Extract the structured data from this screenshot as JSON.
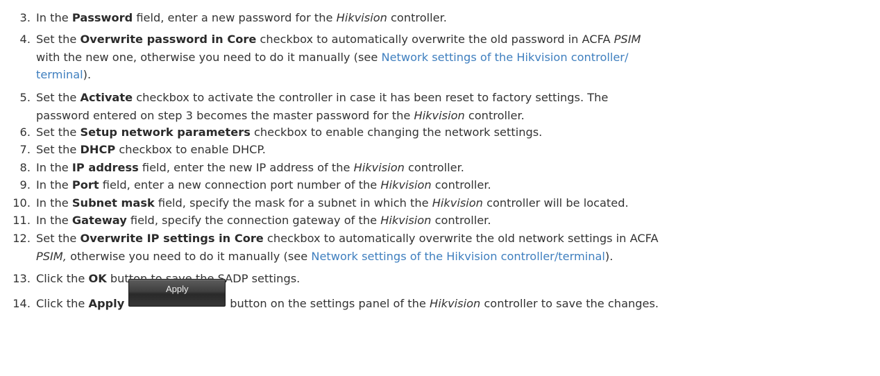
{
  "steps": [
    {
      "number": "3.",
      "parts": [
        {
          "t": "In the "
        },
        {
          "t": "Password",
          "s": "b"
        },
        {
          "t": " field, enter a new password for the "
        },
        {
          "t": "Hikvision",
          "s": "i"
        },
        {
          "t": " controller."
        }
      ]
    },
    {
      "number": "4.",
      "lines": [
        [
          {
            "t": "Set the "
          },
          {
            "t": "Overwrite password in Core",
            "s": "b"
          },
          {
            "t": " checkbox to automatically overwrite the old password in ACFA "
          },
          {
            "t": "PSIM",
            "s": "i"
          }
        ],
        [
          {
            "t": "with the new one, otherwise you need to do it manually (see "
          },
          {
            "t": "Network settings of the Hikvision controller/",
            "s": "a",
            "name": "network-settings-link"
          }
        ],
        [
          {
            "t": "terminal",
            "s": "a",
            "name": "network-settings-link"
          },
          {
            "t": ")."
          }
        ]
      ]
    },
    {
      "number": "5.",
      "lines": [
        [
          {
            "t": "Set the "
          },
          {
            "t": "Activate",
            "s": "b"
          },
          {
            "t": " checkbox to activate the controller in case it has been reset to factory settings. The"
          }
        ],
        [
          {
            "t": "password entered on step 3 becomes the master password for the "
          },
          {
            "t": "Hikvision",
            "s": "i"
          },
          {
            "t": " controller."
          }
        ]
      ]
    },
    {
      "number": "6.",
      "parts": [
        {
          "t": "Set the "
        },
        {
          "t": "Setup network parameters",
          "s": "b"
        },
        {
          "t": " checkbox to enable changing the network settings."
        }
      ]
    },
    {
      "number": "7.",
      "parts": [
        {
          "t": "Set the "
        },
        {
          "t": "DHCP",
          "s": "b"
        },
        {
          "t": " checkbox to enable DHCP."
        }
      ]
    },
    {
      "number": "8.",
      "parts": [
        {
          "t": "In the "
        },
        {
          "t": "IP address",
          "s": "b"
        },
        {
          "t": " field, enter the new IP address of the "
        },
        {
          "t": "Hikvision",
          "s": "i"
        },
        {
          "t": " controller."
        }
      ]
    },
    {
      "number": "9.",
      "parts": [
        {
          "t": "In the "
        },
        {
          "t": "Port",
          "s": "b"
        },
        {
          "t": " field, enter a new connection port number of the "
        },
        {
          "t": "Hikvision",
          "s": "i"
        },
        {
          "t": " controller."
        }
      ]
    },
    {
      "number": "10.",
      "parts": [
        {
          "t": "In the "
        },
        {
          "t": "Subnet mask",
          "s": "b"
        },
        {
          "t": " field, specify the mask for a subnet in which the "
        },
        {
          "t": "Hikvision",
          "s": "i"
        },
        {
          "t": " controller will be located."
        }
      ]
    },
    {
      "number": "11.",
      "parts": [
        {
          "t": "In the "
        },
        {
          "t": "Gateway",
          "s": "b"
        },
        {
          "t": " field, specify the connection gateway of the "
        },
        {
          "t": "Hikvision",
          "s": "i"
        },
        {
          "t": " controller."
        }
      ]
    },
    {
      "number": "12.",
      "lines": [
        [
          {
            "t": "Set the "
          },
          {
            "t": "Overwrite IP settings in Core",
            "s": "b"
          },
          {
            "t": " checkbox to automatically overwrite the old network settings in ACFA"
          }
        ],
        [
          {
            "t": "PSIM,",
            "s": "i"
          },
          {
            "t": " otherwise you need to do it manually (see "
          },
          {
            "t": "Network settings of the Hikvision controller/terminal",
            "s": "a",
            "name": "network-settings-link"
          },
          {
            "t": ")."
          }
        ]
      ]
    },
    {
      "number": "13.",
      "parts": [
        {
          "t": "Click the "
        },
        {
          "t": "OK",
          "s": "b"
        },
        {
          "t": " button to save the SADP settings."
        }
      ]
    },
    {
      "number": "14.",
      "parts": [
        {
          "t": "Click the "
        },
        {
          "t": "Apply",
          "s": "b"
        },
        {
          "t": "Apply",
          "s": "btn"
        },
        {
          "t": "button on the settings panel of the "
        },
        {
          "t": "Hikvision",
          "s": "i"
        },
        {
          "t": " controller to save the changes."
        }
      ]
    }
  ],
  "colors": {
    "text": "#333333",
    "link": "#3f7fbf",
    "button_bg": "#3a3a3a",
    "button_text": "#eeeeee"
  }
}
